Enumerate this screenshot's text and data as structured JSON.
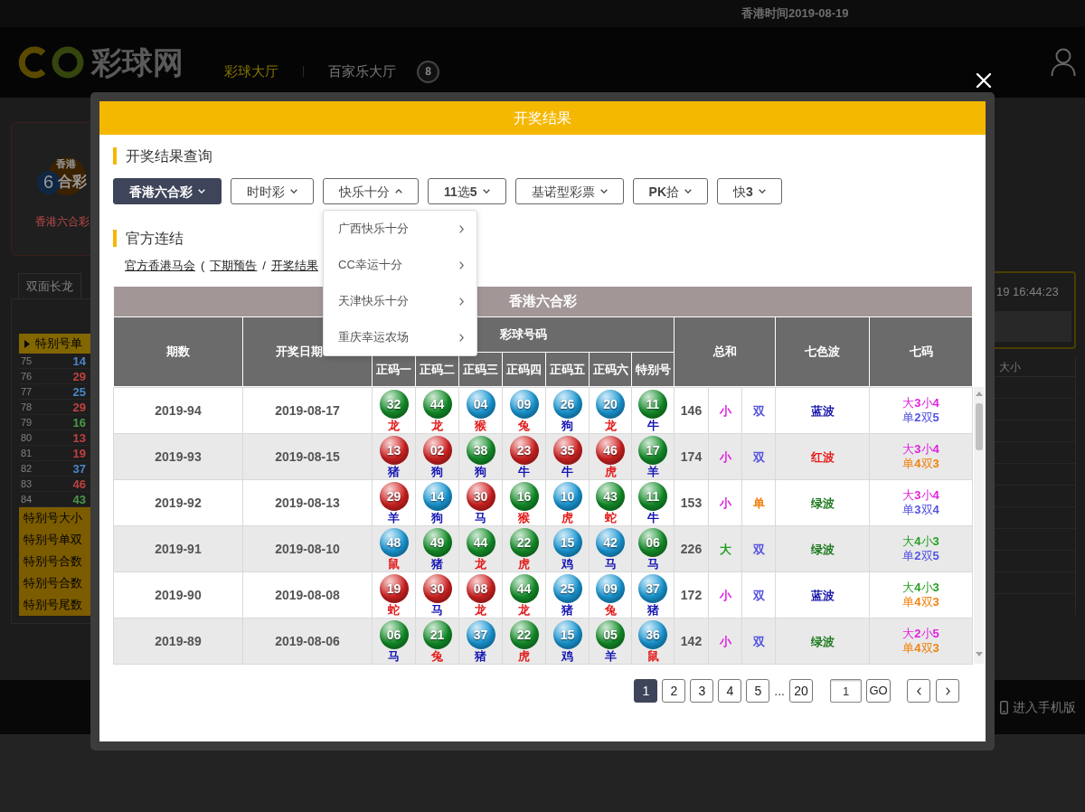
{
  "background": {
    "top_bar": {
      "clock": "香港时间2019-08-19"
    },
    "header": {
      "logo_text": "彩球网",
      "nav": [
        {
          "label": "彩球大厅",
          "selected": true
        },
        {
          "label": "百家乐大厅",
          "selected": false
        }
      ],
      "ball_badge": "8"
    },
    "left_panel": {
      "card": {
        "logo_top": "香港",
        "logo_digit": "6",
        "logo_bottom": "合彩",
        "label": "香港六合彩"
      },
      "tabs": [
        {
          "label": "双面长龙",
          "selected": true
        }
      ],
      "list_heading": "特别号单",
      "rows": [
        {
          "index": "75",
          "value": "14",
          "color": "#4a86c8"
        },
        {
          "index": "76",
          "value": "29",
          "color": "#c04040"
        },
        {
          "index": "77",
          "value": "25",
          "color": "#4a86c8"
        },
        {
          "index": "78",
          "value": "29",
          "color": "#c04040"
        },
        {
          "index": "79",
          "value": "16",
          "color": "#4a9a4a"
        },
        {
          "index": "80",
          "value": "13",
          "color": "#c04040"
        },
        {
          "index": "81",
          "value": "19",
          "color": "#c04040"
        },
        {
          "index": "82",
          "value": "37",
          "color": "#4a86c8"
        },
        {
          "index": "83",
          "value": "46",
          "color": "#c04040"
        },
        {
          "index": "84",
          "value": "43",
          "color": "#4a9a4a"
        }
      ],
      "categories": [
        "特别号大小",
        "特别号单双",
        "特别号合数",
        "特别号合数",
        "特别号尾数"
      ]
    },
    "right_panel": {
      "clock": "19 16:44:23",
      "column": "大小"
    },
    "footer": {
      "mobile_link": "进入手机版"
    }
  },
  "modal": {
    "title": "开奖结果",
    "query": {
      "heading": "开奖结果查询",
      "categories": [
        {
          "label": "香港六合彩",
          "selected": true,
          "expanded": false
        },
        {
          "label": "时时彩",
          "selected": false,
          "expanded": false
        },
        {
          "label": "快乐十分",
          "selected": false,
          "expanded": true,
          "menu": [
            "广西快乐十分",
            "CC幸运十分",
            "天津快乐十分",
            "重庆幸运农场"
          ]
        },
        {
          "label": "**11**选**5**",
          "selected": false,
          "expanded": false
        },
        {
          "label": "基诺型彩票",
          "selected": false,
          "expanded": false
        },
        {
          "label": "**PK**拾",
          "selected": false,
          "expanded": false
        },
        {
          "label": "快**3**",
          "selected": false,
          "expanded": false
        }
      ]
    },
    "links": {
      "heading": "官方连结",
      "items": [
        {
          "kind": "link",
          "text": "官方香港马会"
        },
        {
          "kind": "punct",
          "text": "("
        },
        {
          "kind": "link",
          "text": "下期预告"
        },
        {
          "kind": "punct",
          "text": "/"
        },
        {
          "kind": "link",
          "text": "开奖结果"
        }
      ]
    },
    "table": {
      "title": "香港六合彩",
      "columns": [
        "期数",
        "开奖日期"
      ],
      "ball_group": {
        "label": "彩球号码",
        "columns": [
          "正码一",
          "正码二",
          "正码三",
          "正码四",
          "正码五",
          "正码六",
          "特别号"
        ]
      },
      "tail_columns": [
        "总和",
        "七色波",
        "七码"
      ],
      "rows": [
        {
          "period": "2019-94",
          "date": "2019-08-17",
          "balls": [
            {
              "number": "32",
              "color": "#14902a",
              "zodiac": {
                "text": "龙",
                "color": "#e31b1b"
              }
            },
            {
              "number": "44",
              "color": "#14902a",
              "zodiac": {
                "text": "龙",
                "color": "#e31b1b"
              }
            },
            {
              "number": "04",
              "color": "#1a9ad8",
              "zodiac": {
                "text": "猴",
                "color": "#e31b1b"
              }
            },
            {
              "number": "09",
              "color": "#1a9ad8",
              "zodiac": {
                "text": "兔",
                "color": "#e31b1b"
              }
            },
            {
              "number": "26",
              "color": "#1a9ad8",
              "zodiac": {
                "text": "狗",
                "color": "#1414b4"
              }
            },
            {
              "number": "20",
              "color": "#1a9ad8",
              "zodiac": {
                "text": "龙",
                "color": "#e31b1b"
              }
            },
            {
              "number": "11",
              "color": "#14902a",
              "zodiac": {
                "text": "牛",
                "color": "#1414b4"
              }
            }
          ],
          "sum": "146",
          "size": {
            "text": "小",
            "color": "#e01ee0"
          },
          "parity": {
            "text": "双",
            "color": "#5252e0"
          },
          "wave": {
            "text": "蓝波",
            "color": "#1515a8"
          },
          "seven": [
            {
              "text": "大**3**小**4**",
              "color": "#e01ee0"
            },
            {
              "text": "单**2**双**5**",
              "color": "#5252e0"
            }
          ]
        },
        {
          "period": "2019-93",
          "date": "2019-08-15",
          "balls": [
            {
              "number": "13",
              "color": "#d42222",
              "zodiac": {
                "text": "猪",
                "color": "#1414b4"
              }
            },
            {
              "number": "02",
              "color": "#d42222",
              "zodiac": {
                "text": "狗",
                "color": "#1414b4"
              }
            },
            {
              "number": "38",
              "color": "#14902a",
              "zodiac": {
                "text": "狗",
                "color": "#1414b4"
              }
            },
            {
              "number": "23",
              "color": "#d42222",
              "zodiac": {
                "text": "牛",
                "color": "#1414b4"
              }
            },
            {
              "number": "35",
              "color": "#d42222",
              "zodiac": {
                "text": "牛",
                "color": "#1414b4"
              }
            },
            {
              "number": "46",
              "color": "#d42222",
              "zodiac": {
                "text": "虎",
                "color": "#e31b1b"
              }
            },
            {
              "number": "17",
              "color": "#14902a",
              "zodiac": {
                "text": "羊",
                "color": "#1414b4"
              }
            }
          ],
          "sum": "174",
          "size": {
            "text": "小",
            "color": "#e01ee0"
          },
          "parity": {
            "text": "双",
            "color": "#5252e0"
          },
          "wave": {
            "text": "红波",
            "color": "#e31b1b"
          },
          "seven": [
            {
              "text": "大**3**小**4**",
              "color": "#e01ee0"
            },
            {
              "text": "单**4**双**3**",
              "color": "#f0820f"
            }
          ]
        },
        {
          "period": "2019-92",
          "date": "2019-08-13",
          "balls": [
            {
              "number": "29",
              "color": "#d42222",
              "zodiac": {
                "text": "羊",
                "color": "#1414b4"
              }
            },
            {
              "number": "14",
              "color": "#1a9ad8",
              "zodiac": {
                "text": "狗",
                "color": "#1414b4"
              }
            },
            {
              "number": "30",
              "color": "#d42222",
              "zodiac": {
                "text": "马",
                "color": "#1414b4"
              }
            },
            {
              "number": "16",
              "color": "#14902a",
              "zodiac": {
                "text": "猴",
                "color": "#e31b1b"
              }
            },
            {
              "number": "10",
              "color": "#1a9ad8",
              "zodiac": {
                "text": "虎",
                "color": "#e31b1b"
              }
            },
            {
              "number": "43",
              "color": "#14902a",
              "zodiac": {
                "text": "蛇",
                "color": "#e31b1b"
              }
            },
            {
              "number": "11",
              "color": "#14902a",
              "zodiac": {
                "text": "牛",
                "color": "#1414b4"
              }
            }
          ],
          "sum": "153",
          "size": {
            "text": "小",
            "color": "#e01ee0"
          },
          "parity": {
            "text": "单",
            "color": "#f0820f"
          },
          "wave": {
            "text": "绿波",
            "color": "#1f7a1f"
          },
          "seven": [
            {
              "text": "大**3**小**4**",
              "color": "#e01ee0"
            },
            {
              "text": "单**3**双**4**",
              "color": "#5252e0"
            }
          ]
        },
        {
          "period": "2019-91",
          "date": "2019-08-10",
          "balls": [
            {
              "number": "48",
              "color": "#1a9ad8",
              "zodiac": {
                "text": "鼠",
                "color": "#e31b1b"
              }
            },
            {
              "number": "49",
              "color": "#14902a",
              "zodiac": {
                "text": "猪",
                "color": "#1414b4"
              }
            },
            {
              "number": "44",
              "color": "#14902a",
              "zodiac": {
                "text": "龙",
                "color": "#e31b1b"
              }
            },
            {
              "number": "22",
              "color": "#14902a",
              "zodiac": {
                "text": "虎",
                "color": "#e31b1b"
              }
            },
            {
              "number": "15",
              "color": "#1a9ad8",
              "zodiac": {
                "text": "鸡",
                "color": "#1414b4"
              }
            },
            {
              "number": "42",
              "color": "#1a9ad8",
              "zodiac": {
                "text": "马",
                "color": "#1414b4"
              }
            },
            {
              "number": "06",
              "color": "#14902a",
              "zodiac": {
                "text": "马",
                "color": "#1414b4"
              }
            }
          ],
          "sum": "226",
          "size": {
            "text": "大",
            "color": "#22a022"
          },
          "parity": {
            "text": "双",
            "color": "#5252e0"
          },
          "wave": {
            "text": "绿波",
            "color": "#1f7a1f"
          },
          "seven": [
            {
              "text": "大**4**小**3**",
              "color": "#22a022"
            },
            {
              "text": "单**2**双**5**",
              "color": "#5252e0"
            }
          ]
        },
        {
          "period": "2019-90",
          "date": "2019-08-08",
          "balls": [
            {
              "number": "19",
              "color": "#d42222",
              "zodiac": {
                "text": "蛇",
                "color": "#e31b1b"
              }
            },
            {
              "number": "30",
              "color": "#d42222",
              "zodiac": {
                "text": "马",
                "color": "#1414b4"
              }
            },
            {
              "number": "08",
              "color": "#d42222",
              "zodiac": {
                "text": "龙",
                "color": "#e31b1b"
              }
            },
            {
              "number": "44",
              "color": "#14902a",
              "zodiac": {
                "text": "龙",
                "color": "#e31b1b"
              }
            },
            {
              "number": "25",
              "color": "#1a9ad8",
              "zodiac": {
                "text": "猪",
                "color": "#1414b4"
              }
            },
            {
              "number": "09",
              "color": "#1a9ad8",
              "zodiac": {
                "text": "兔",
                "color": "#e31b1b"
              }
            },
            {
              "number": "37",
              "color": "#1a9ad8",
              "zodiac": {
                "text": "猪",
                "color": "#1414b4"
              }
            }
          ],
          "sum": "172",
          "size": {
            "text": "小",
            "color": "#e01ee0"
          },
          "parity": {
            "text": "双",
            "color": "#5252e0"
          },
          "wave": {
            "text": "蓝波",
            "color": "#1515a8"
          },
          "seven": [
            {
              "text": "大**4**小**3**",
              "color": "#22a022"
            },
            {
              "text": "单**4**双**3**",
              "color": "#f0820f"
            }
          ]
        },
        {
          "period": "2019-89",
          "date": "2019-08-06",
          "balls": [
            {
              "number": "06",
              "color": "#14902a",
              "zodiac": {
                "text": "马",
                "color": "#1414b4"
              }
            },
            {
              "number": "21",
              "color": "#14902a",
              "zodiac": {
                "text": "兔",
                "color": "#e31b1b"
              }
            },
            {
              "number": "37",
              "color": "#1a9ad8",
              "zodiac": {
                "text": "猪",
                "color": "#1414b4"
              }
            },
            {
              "number": "22",
              "color": "#14902a",
              "zodiac": {
                "text": "虎",
                "color": "#e31b1b"
              }
            },
            {
              "number": "15",
              "color": "#1a9ad8",
              "zodiac": {
                "text": "鸡",
                "color": "#1414b4"
              }
            },
            {
              "number": "05",
              "color": "#14902a",
              "zodiac": {
                "text": "羊",
                "color": "#1414b4"
              }
            },
            {
              "number": "36",
              "color": "#1a9ad8",
              "zodiac": {
                "text": "鼠",
                "color": "#e31b1b"
              }
            }
          ],
          "sum": "142",
          "size": {
            "text": "小",
            "color": "#e01ee0"
          },
          "parity": {
            "text": "双",
            "color": "#5252e0"
          },
          "wave": {
            "text": "绿波",
            "color": "#1f7a1f"
          },
          "seven": [
            {
              "text": "大**2**小**5**",
              "color": "#e01ee0"
            },
            {
              "text": "单**4**双**3**",
              "color": "#f0820f"
            }
          ]
        }
      ]
    },
    "pagination": {
      "pages": [
        {
          "label": "1",
          "selected": true
        },
        {
          "label": "2",
          "selected": false
        },
        {
          "label": "3",
          "selected": false
        },
        {
          "label": "4",
          "selected": false
        },
        {
          "label": "5",
          "selected": false
        }
      ],
      "ellipsis": "...",
      "last_page": {
        "label": "20",
        "selected": false
      },
      "jump_value": "1",
      "go": "GO"
    }
  }
}
